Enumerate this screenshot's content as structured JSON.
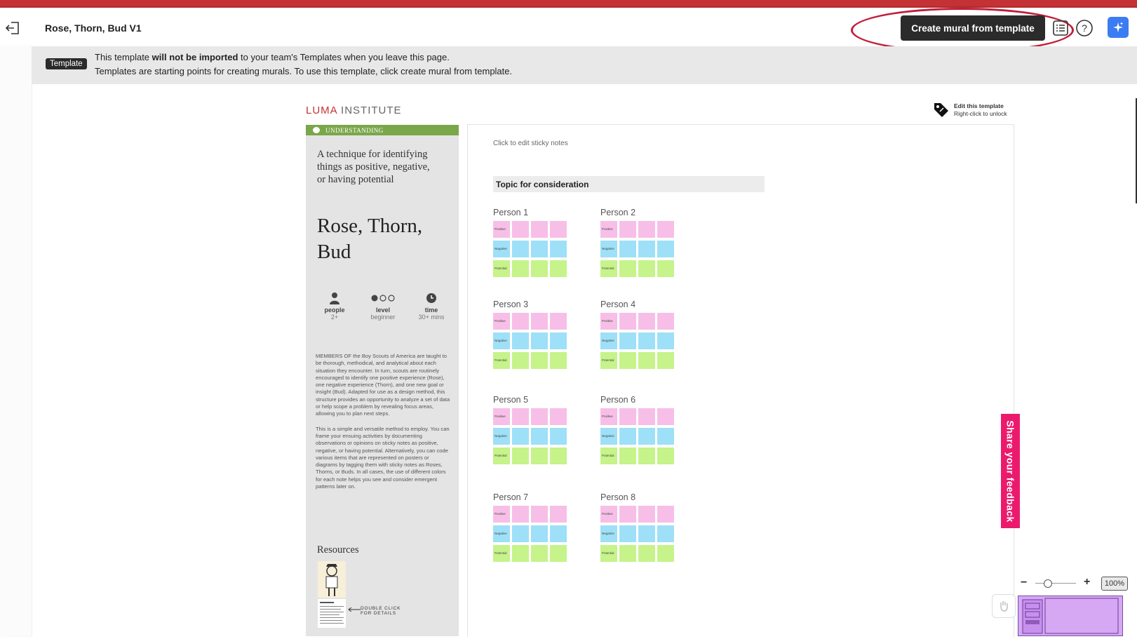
{
  "header": {
    "title": "Rose, Thorn, Bud V1",
    "create_button": "Create mural from template"
  },
  "banner": {
    "badge": "Template",
    "line1_pre": "This template ",
    "line1_bold": "will not be imported",
    "line1_post": " to your team's Templates when you leave this page.",
    "line2": "Templates are starting points for creating murals. To use this template, click create mural from template."
  },
  "brand": {
    "part1": "LUMA",
    "part2": " INSTITUTE"
  },
  "edit_note": {
    "title": "Edit this template",
    "subtitle": "Right-click to unlock"
  },
  "panel": {
    "category": "UNDERSTANDING",
    "description": "A technique for identifying things as positive, negative, or having potential",
    "method_name": "Rose, Thorn, Bud",
    "stats": [
      {
        "label": "people",
        "value": "2+"
      },
      {
        "label": "level",
        "value": "beginner"
      },
      {
        "label": "time",
        "value": "30+ mins"
      }
    ],
    "body1": "MEMBERS OF the Boy Scouts of America are taught to be thorough, methodical, and analytical about each situation they encounter. In turn, scouts are routinely encouraged to identify one positive experience (Rose), one negative experience (Thorn), and one new goal or insight (Bud). Adapted for use as a design method, this structure provides an opportunity to analyze a set of data or help scope a problem by revealing focus areas, allowing you to plan next steps.",
    "body2": "This is a simple and versatile method to employ. You can frame your ensuing activities by documenting observations or opinions on sticky notes as positive, negative, or having potential. Alternatively, you can code various items that are represented on posters or diagrams by tagging them with sticky notes as Roses, Thorns, or Buds. In all cases, the use of different colors for each note helps you see and consider emergent patterns later on.",
    "resources_title": "Resources",
    "double_click": "DOUBLE CLICK FOR DETAILS"
  },
  "board": {
    "hint": "Click to edit sticky notes",
    "topic": "Topic for consideration",
    "row_labels": [
      "Positive",
      "Negative",
      "Potential"
    ],
    "persons": [
      "Person 1",
      "Person 2",
      "Person 3",
      "Person 4",
      "Person 5",
      "Person 6",
      "Person 7",
      "Person 8"
    ]
  },
  "feedback": "Share your feedback",
  "zoom": {
    "minus": "−",
    "plus": "+",
    "percent": "100%"
  },
  "colors": {
    "positive": "#f7bfe7",
    "negative": "#9ee0f7",
    "potential": "#c6f38a",
    "accent": "#3b7cf2",
    "feedback": "#ec1a6d",
    "category": "#7aa74a"
  }
}
